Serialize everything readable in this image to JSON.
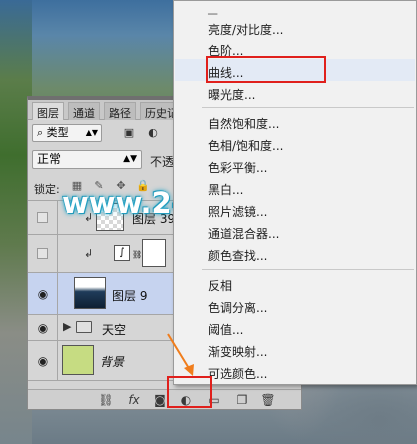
{
  "panel": {
    "tabs": [
      "图层",
      "通道",
      "路径",
      "历史记"
    ],
    "filter": {
      "label": "类型"
    },
    "blend_mode": "正常",
    "opacity_label": "不透",
    "lock_label": "锁定:",
    "layers": [
      {
        "name": "图层 39",
        "visible": false,
        "clipped": true,
        "type": "pixel"
      },
      {
        "name": "",
        "visible": false,
        "clipped": true,
        "type": "curves-adjustment"
      },
      {
        "name": "图层 9",
        "visible": true,
        "clipped": false,
        "type": "pixel",
        "selected": true
      },
      {
        "name": "天空",
        "visible": true,
        "clipped": false,
        "type": "group"
      },
      {
        "name": "背景",
        "visible": true,
        "clipped": false,
        "type": "background"
      }
    ],
    "bottom_icons": [
      "link-icon",
      "fx-icon",
      "mask-icon",
      "adjustment-icon",
      "group-icon",
      "new-layer-icon",
      "trash-icon"
    ]
  },
  "menu": {
    "items_group1": [
      "亮度/对比度...",
      "色阶...",
      "曲线...",
      "曝光度..."
    ],
    "items_group2": [
      "自然饱和度...",
      "色相/饱和度...",
      "色彩平衡...",
      "黑白...",
      "照片滤镜...",
      "通道混合器...",
      "颜色查找..."
    ],
    "items_group3": [
      "反相",
      "色调分离...",
      "阈值...",
      "渐变映射...",
      "可选颜色..."
    ],
    "highlighted_item": "曲线..."
  },
  "watermark": "www.240PS.com",
  "colors": {
    "highlight": "#e0201c",
    "arrow": "#f07d1c",
    "selection": "#c6d3ef"
  }
}
